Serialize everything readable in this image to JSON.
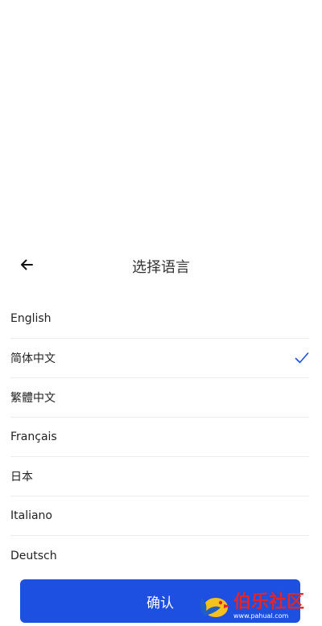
{
  "header": {
    "title": "选择语言"
  },
  "icons": {
    "back": "arrow-left-icon",
    "check": "check-icon",
    "accent_color": "#1d4fe0"
  },
  "languages": [
    {
      "label": "English",
      "selected": false
    },
    {
      "label": "简体中文",
      "selected": true
    },
    {
      "label": "繁體中文",
      "selected": false
    },
    {
      "label": "Français",
      "selected": false
    },
    {
      "label": "日本",
      "selected": false
    },
    {
      "label": "Italiano",
      "selected": false
    },
    {
      "label": "Deutsch",
      "selected": false
    }
  ],
  "footer": {
    "confirm_label": "确认"
  },
  "watermark": {
    "title": "伯乐社区",
    "url": "www.pahual.com"
  }
}
